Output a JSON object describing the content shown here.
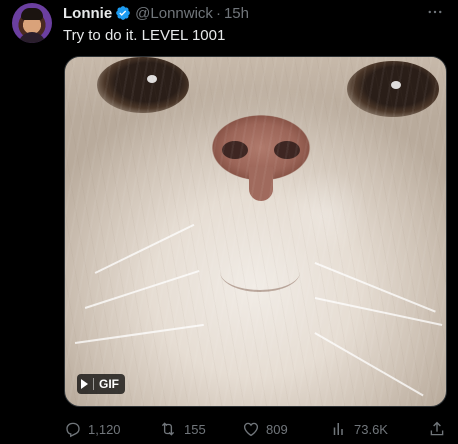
{
  "tweet": {
    "author_name": "Lonnie",
    "handle": "@Lonnwick",
    "separator": "·",
    "time": "15h",
    "text": "Try to do it. LEVEL 1001",
    "media": {
      "badge_label": "GIF"
    },
    "actions": {
      "replies": "1,120",
      "retweets": "155",
      "likes": "809",
      "views": "73.6K"
    }
  },
  "colors": {
    "background": "#000000",
    "text": "#e7e9ea",
    "muted": "#71767b",
    "verified": "#1d9bf0"
  },
  "icons": [
    "verified-badge-icon",
    "more-icon",
    "play-icon",
    "reply-icon",
    "retweet-icon",
    "like-icon",
    "views-icon",
    "share-icon"
  ]
}
